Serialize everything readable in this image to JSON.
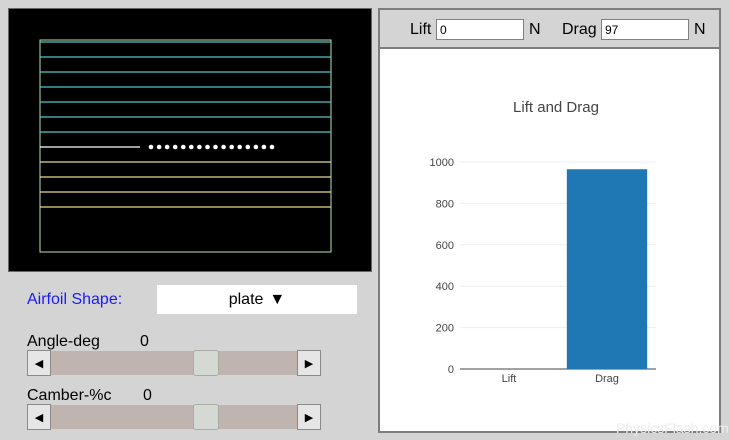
{
  "simulation": {
    "streamline_colors": {
      "upper": "#4fc6c9",
      "lower": "#e8d98c",
      "frame": "#b4e3b6",
      "center": "#ffffff"
    },
    "particle_count": 16
  },
  "airfoil": {
    "label": "Airfoil Shape:",
    "selected": "plate",
    "arrow": "▼"
  },
  "angle": {
    "label": "Angle-deg",
    "value": "0",
    "fraction": 0.63
  },
  "camber": {
    "label": "Camber-%c",
    "value": "0",
    "fraction": 0.63
  },
  "slider_arrows": {
    "left": "◀",
    "right": "▶"
  },
  "forces": {
    "lift_label": "Lift",
    "lift_value": "0",
    "lift_unit": "N",
    "drag_label": "Drag",
    "drag_value": "97",
    "drag_unit": "N"
  },
  "chart_data": {
    "type": "bar",
    "title": "Lift and Drag",
    "categories": [
      "Lift",
      "Drag"
    ],
    "values": [
      0,
      965
    ],
    "yticks": [
      0,
      200,
      400,
      600,
      800,
      1000
    ],
    "ylim": [
      0,
      1000
    ],
    "grid": true,
    "bar_color": "#1f77b4"
  },
  "watermark": "PhysicsFlash.com"
}
